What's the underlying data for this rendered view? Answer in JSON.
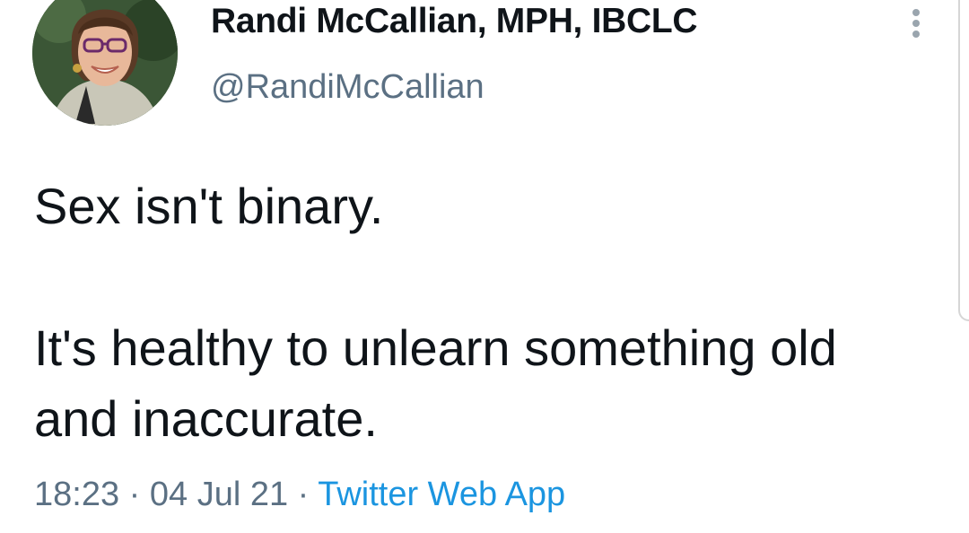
{
  "author": {
    "display_name": "Randi McCallian, MPH, IBCLC",
    "handle": "@RandiMcCallian",
    "avatar_icon": "profile-photo"
  },
  "menu": {
    "icon": "more-vertical-icon"
  },
  "tweet": {
    "text": "Sex isn't binary.\n\nIt's healthy to unlearn something old and inaccurate."
  },
  "meta": {
    "time": "18:23",
    "separator": "·",
    "date": "04 Jul 21",
    "source": "Twitter Web App"
  },
  "colors": {
    "text": "#0f1419",
    "secondary": "#5b7083",
    "link": "#1b95e0"
  }
}
